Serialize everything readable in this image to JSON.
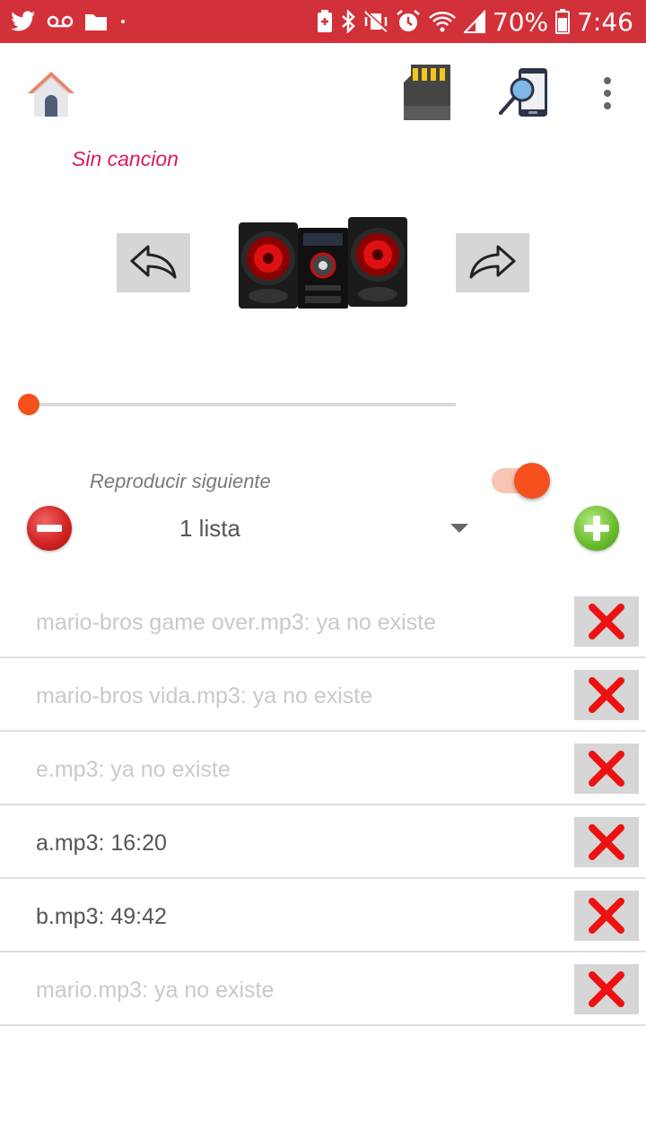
{
  "status_bar": {
    "battery_percent": "70%",
    "time": "7:46",
    "left_icons": [
      "twitter-icon",
      "voicemail-icon",
      "folder-icon",
      "dot-icon"
    ],
    "right_icons": [
      "battery-saver-icon",
      "bluetooth-icon",
      "vibrate-off-icon",
      "alarm-icon",
      "wifi-icon",
      "signal-icon",
      "battery-icon"
    ]
  },
  "toolbar": {
    "icons": [
      "home-icon",
      "sd-card-icon",
      "phone-search-icon",
      "more-vert-icon"
    ]
  },
  "player": {
    "current_song": "Sin cancion",
    "progress": 0,
    "image": "stereo-system-icon"
  },
  "autoplay": {
    "label": "Reproducir siguiente",
    "enabled": true
  },
  "playlist": {
    "selected": "1 lista"
  },
  "songs": [
    {
      "text": "mario-bros game over.mp3: ya no existe",
      "available": false
    },
    {
      "text": "mario-bros vida.mp3: ya no existe",
      "available": false
    },
    {
      "text": "e.mp3: ya no existe",
      "available": false
    },
    {
      "text": "a.mp3: 16:20",
      "available": true
    },
    {
      "text": "b.mp3: 49:42",
      "available": true
    },
    {
      "text": "mario.mp3: ya no existe",
      "available": false
    }
  ],
  "colors": {
    "status_bar": "#d3313a",
    "accent": "#f4511e",
    "title": "#d81b60",
    "delete_x": "#ee1111"
  }
}
